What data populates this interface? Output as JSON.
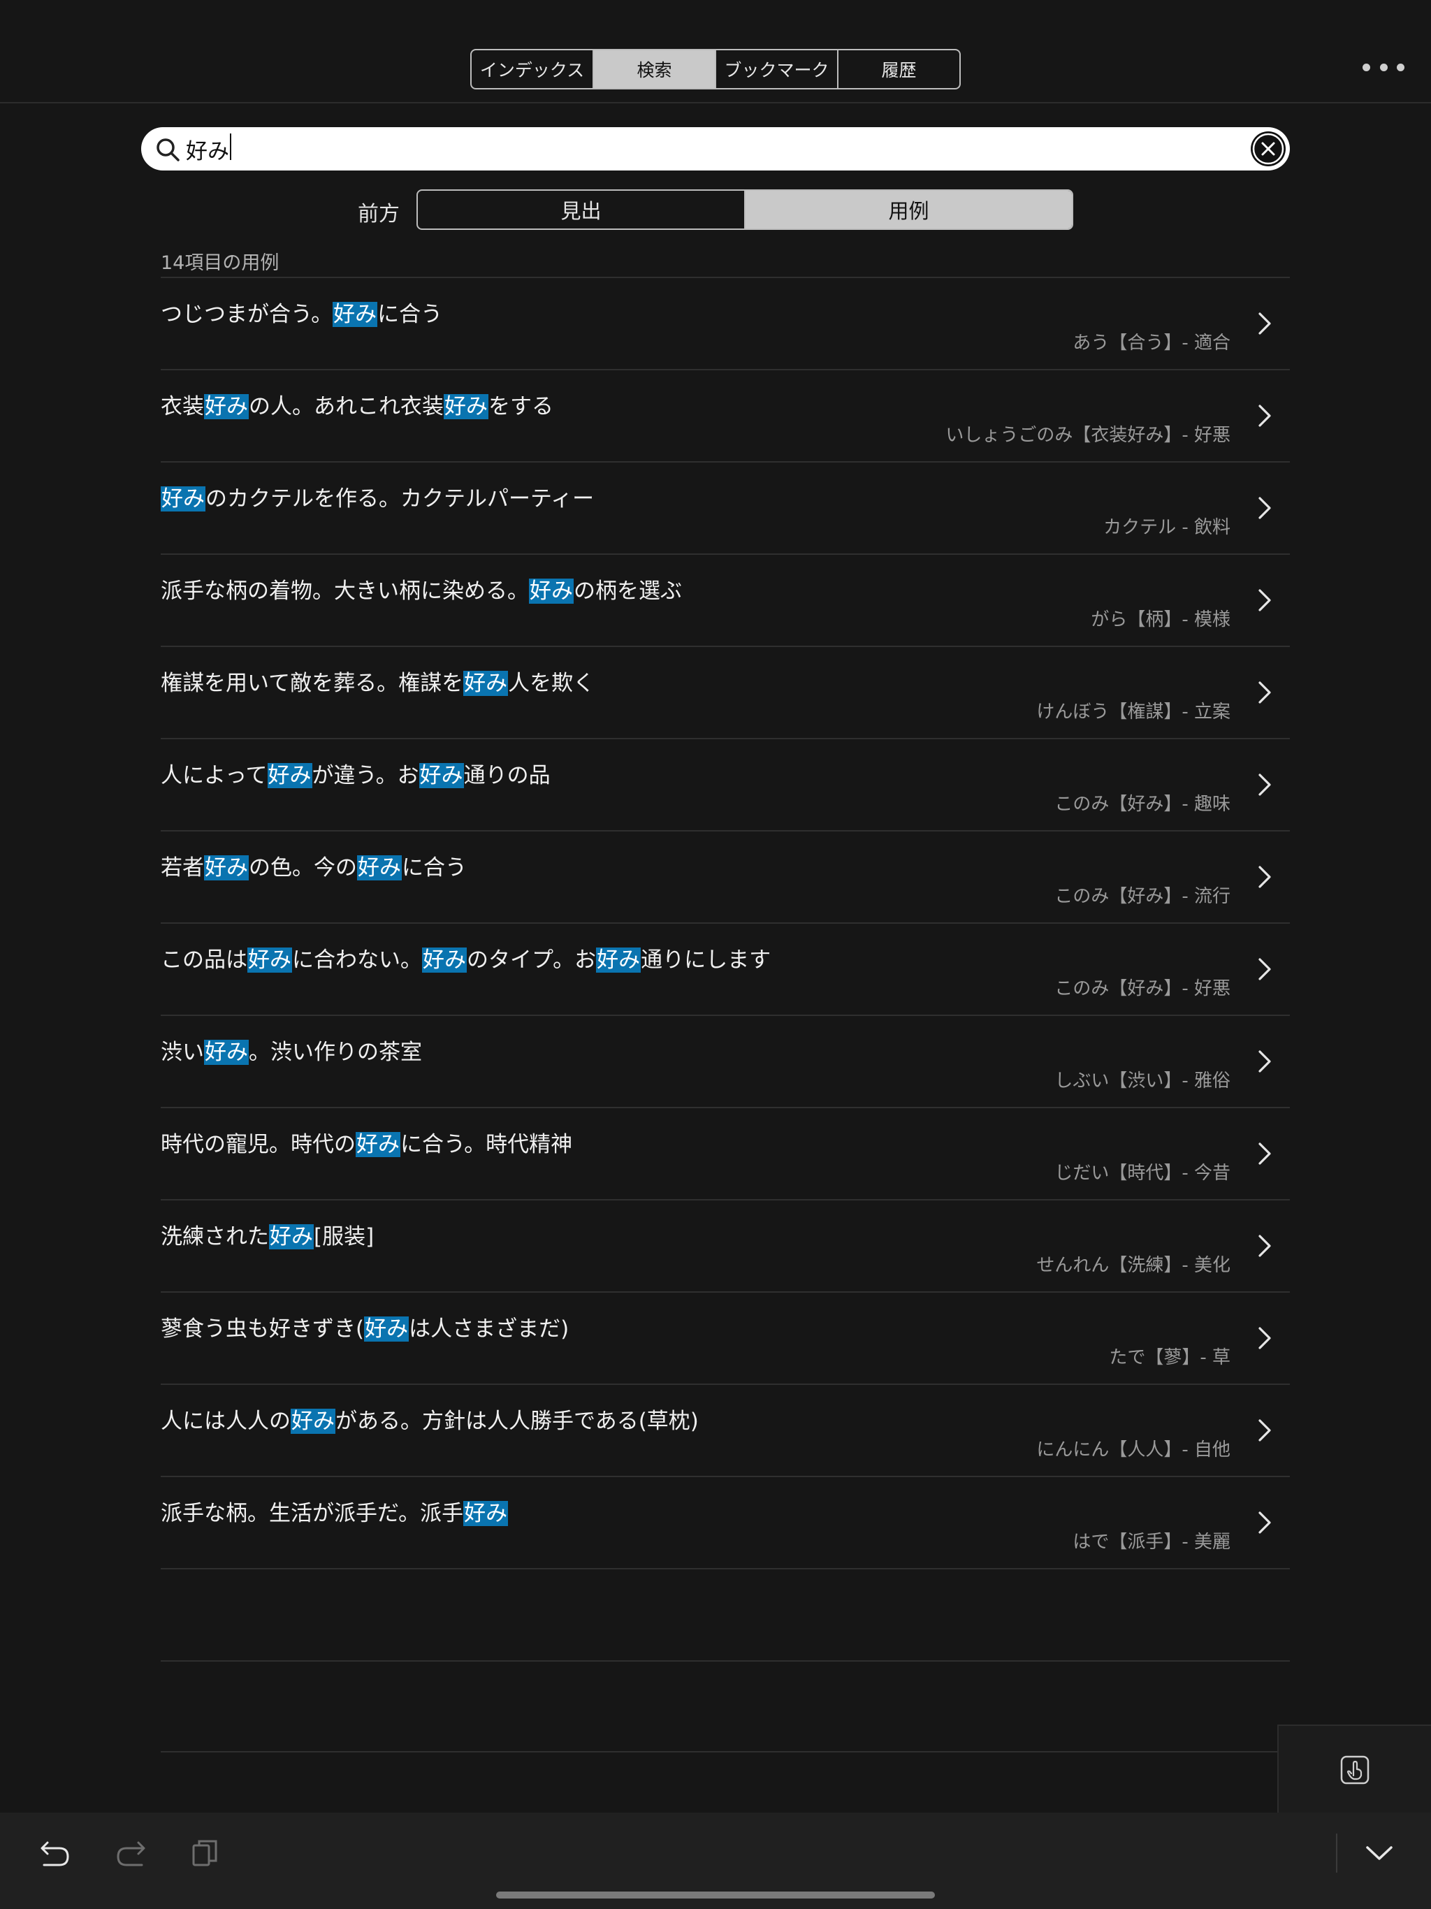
{
  "tabs": [
    {
      "label": "インデックス",
      "active": false
    },
    {
      "label": "検索",
      "active": true
    },
    {
      "label": "ブックマーク",
      "active": false
    },
    {
      "label": "履歴",
      "active": false
    }
  ],
  "search": {
    "value": "好み",
    "placeholder": ""
  },
  "mode": {
    "label": "前方",
    "segments": [
      {
        "label": "見出",
        "active": false
      },
      {
        "label": "用例",
        "active": true
      }
    ]
  },
  "result_count": "14項目の用例",
  "results": [
    {
      "example": "つじつまが合う。好みに合う",
      "source": "あう【合う】- 適合"
    },
    {
      "example": "衣装好みの人。あれこれ衣装好みをする",
      "source": "いしょうごのみ【衣装好み】- 好悪"
    },
    {
      "example": "好みのカクテルを作る。カクテルパーティー",
      "source": "カクテル - 飲料"
    },
    {
      "example": "派手な柄の着物。大きい柄に染める。好みの柄を選ぶ",
      "source": "がら【柄】- 模様"
    },
    {
      "example": "権謀を用いて敵を葬る。権謀を好み人を欺く",
      "source": "けんぼう【権謀】- 立案"
    },
    {
      "example": "人によって好みが違う。お好み通りの品",
      "source": "このみ【好み】- 趣味"
    },
    {
      "example": "若者好みの色。今の好みに合う",
      "source": "このみ【好み】- 流行"
    },
    {
      "example": "この品は好みに合わない。好みのタイプ。お好み通りにします",
      "source": "このみ【好み】- 好悪"
    },
    {
      "example": "渋い好み。渋い作りの茶室",
      "source": "しぶい【渋い】- 雅俗"
    },
    {
      "example": "時代の寵児。時代の好みに合う。時代精神",
      "source": "じだい【時代】- 今昔"
    },
    {
      "example": "洗練された好み[服装]",
      "source": "せんれん【洗練】- 美化"
    },
    {
      "example": "蓼食う虫も好きずき(好みは人さまざまだ)",
      "source": "たで【蓼】- 草"
    },
    {
      "example": "人には人人の好みがある。方針は人人勝手である(草枕)",
      "source": "にんにん【人人】- 自他"
    },
    {
      "example": "派手な柄。生活が派手だ。派手好み",
      "source": "はで【派手】- 美麗"
    }
  ],
  "highlight_color": "#0a74b0",
  "icons": {
    "search": "search-icon",
    "clear": "clear-icon",
    "more": "more-icon",
    "chevron": "chevron-right-icon",
    "undo": "undo-icon",
    "redo": "redo-icon",
    "copy": "copy-icon",
    "gesture": "hand-pointer-icon",
    "collapse": "chevron-down-icon"
  }
}
